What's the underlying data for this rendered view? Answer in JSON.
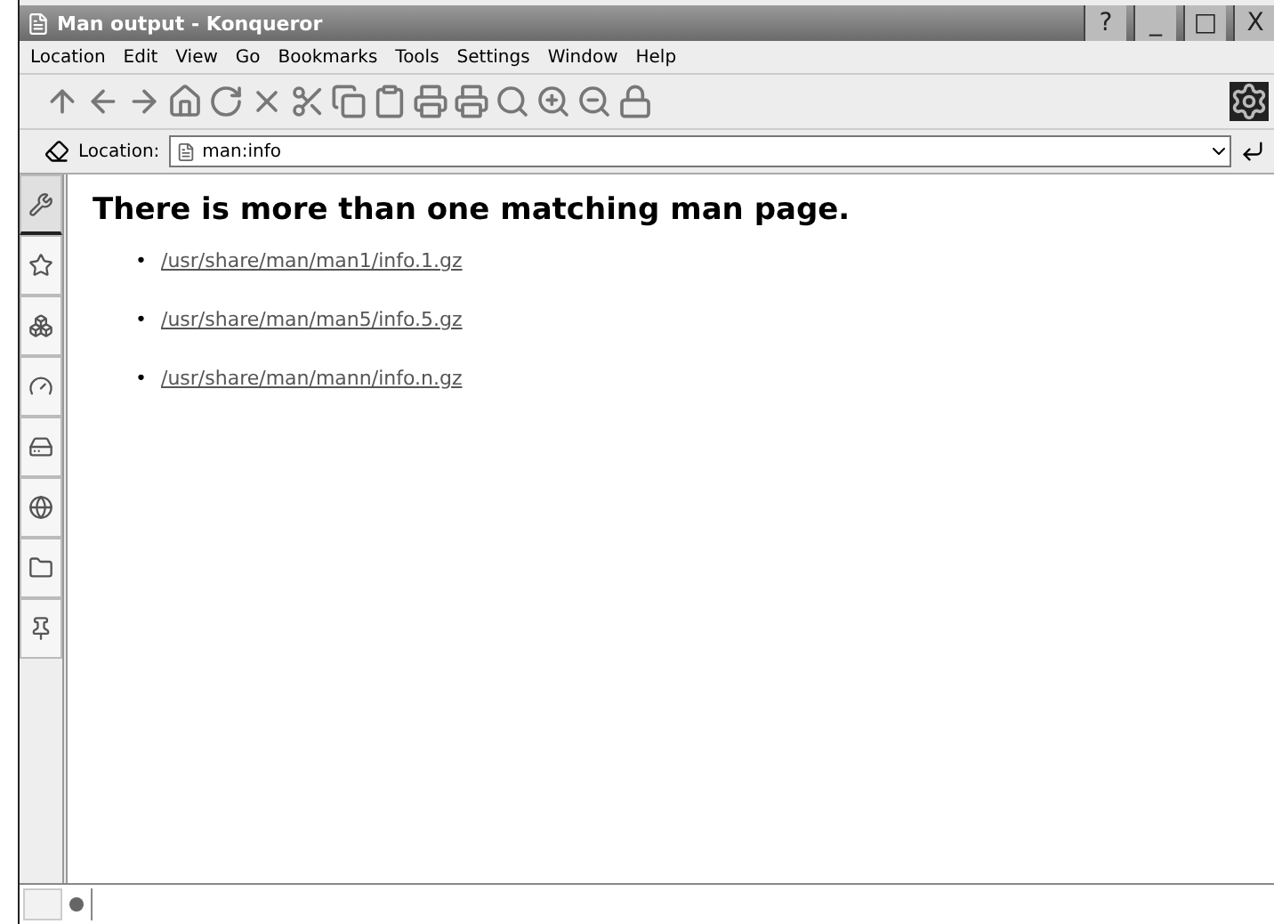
{
  "window": {
    "title": "Man output - Konqueror",
    "controls": [
      "?",
      "_",
      "□",
      "X"
    ]
  },
  "menu": [
    "Location",
    "Edit",
    "View",
    "Go",
    "Bookmarks",
    "Tools",
    "Settings",
    "Window",
    "Help"
  ],
  "location_bar": {
    "label": "Location:",
    "value": "man:info"
  },
  "sidebar": {
    "tabs": [
      {
        "selected": true
      },
      {
        "selected": false
      },
      {
        "selected": false
      },
      {
        "selected": false
      },
      {
        "selected": false
      },
      {
        "selected": false
      },
      {
        "selected": false
      },
      {
        "selected": false
      }
    ]
  },
  "page": {
    "heading": "There is more than one matching man page.",
    "links": [
      {
        "bullet": "•",
        "text": "/usr/share/man/man1/info.1.gz"
      },
      {
        "bullet": "•",
        "text": "/usr/share/man/man5/info.5.gz"
      },
      {
        "bullet": "•",
        "text": "/usr/share/man/mann/info.n.gz"
      }
    ]
  }
}
